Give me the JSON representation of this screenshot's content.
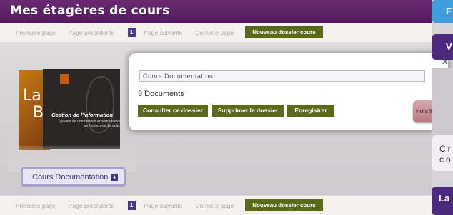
{
  "header": {
    "title": "Mes étagères de cours"
  },
  "pager": {
    "first": "Première page",
    "previous": "Page précédente",
    "current": "1",
    "next": "Page suivante",
    "last": "Dernière page",
    "new_folder": "Nouveau dossier cours"
  },
  "shelf": {
    "folder_label": "Cours Documentation",
    "book": {
      "left_text_1": "La R",
      "left_text_2": "B",
      "title": "Gestion de l'information",
      "subtitle": "Qualité de l'information et performances de l'entreprise 2e édition"
    }
  },
  "popup": {
    "folder_name_value": "Cours Documentation",
    "document_count": "3 Documents",
    "buttons": {
      "view": "Consulter ce dossier",
      "delete": "Supprimer le dossier",
      "save": "Enregistrer"
    },
    "close": "x"
  },
  "offline_button": "Hors ligne",
  "right_panel": {
    "item1": "F",
    "item2": "V",
    "item4_line1": "Cr",
    "item4_line2": "co",
    "item5": "La"
  },
  "colors": {
    "header_bg": "#5e2266",
    "accent_green": "#5b6a1a",
    "page_number_bg": "#4b3a8c"
  }
}
